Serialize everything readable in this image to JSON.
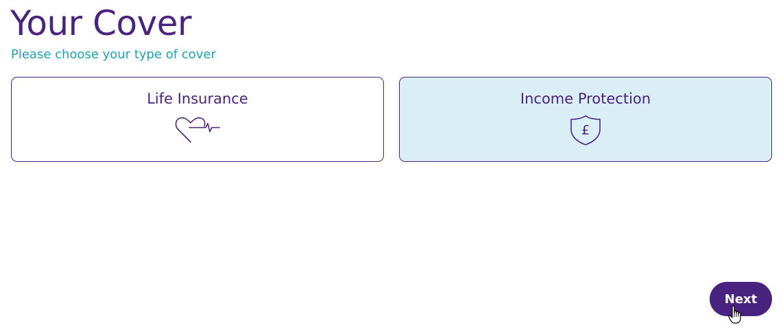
{
  "page": {
    "title": "Your Cover",
    "subtitle": "Please choose your type of cover"
  },
  "options": [
    {
      "label": "Life Insurance",
      "icon": "heart-pulse-icon",
      "selected": false
    },
    {
      "label": "Income Protection",
      "icon": "shield-pound-icon",
      "selected": true
    }
  ],
  "actions": {
    "next_label": "Next"
  },
  "colors": {
    "brand_purple": "#4a2380",
    "subtitle_teal": "#1aa3b8",
    "selected_bg": "#daeef6"
  }
}
